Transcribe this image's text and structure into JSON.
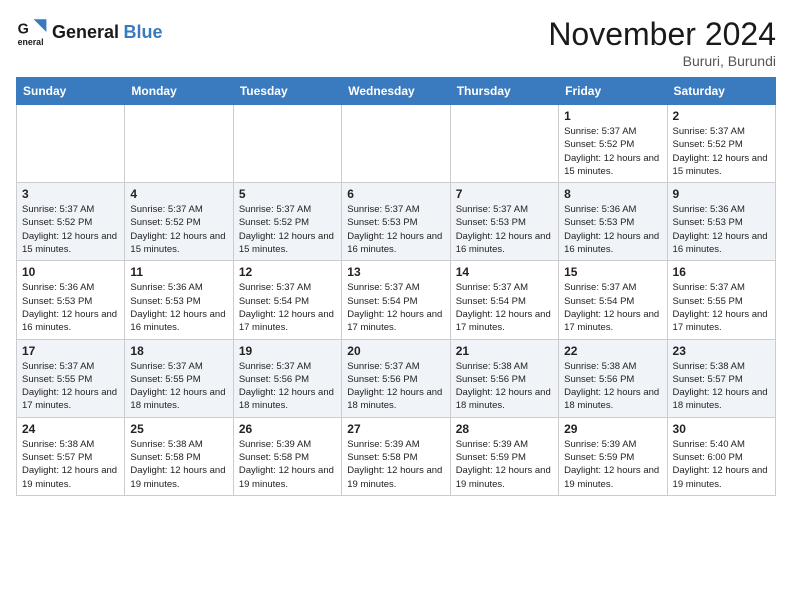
{
  "header": {
    "logo_line1": "General",
    "logo_line2": "Blue",
    "month": "November 2024",
    "location": "Bururi, Burundi"
  },
  "weekdays": [
    "Sunday",
    "Monday",
    "Tuesday",
    "Wednesday",
    "Thursday",
    "Friday",
    "Saturday"
  ],
  "weeks": [
    [
      {
        "day": "",
        "sunrise": "",
        "sunset": "",
        "daylight": ""
      },
      {
        "day": "",
        "sunrise": "",
        "sunset": "",
        "daylight": ""
      },
      {
        "day": "",
        "sunrise": "",
        "sunset": "",
        "daylight": ""
      },
      {
        "day": "",
        "sunrise": "",
        "sunset": "",
        "daylight": ""
      },
      {
        "day": "",
        "sunrise": "",
        "sunset": "",
        "daylight": ""
      },
      {
        "day": "1",
        "sunrise": "5:37 AM",
        "sunset": "5:52 PM",
        "daylight": "12 hours and 15 minutes."
      },
      {
        "day": "2",
        "sunrise": "5:37 AM",
        "sunset": "5:52 PM",
        "daylight": "12 hours and 15 minutes."
      }
    ],
    [
      {
        "day": "3",
        "sunrise": "5:37 AM",
        "sunset": "5:52 PM",
        "daylight": "12 hours and 15 minutes."
      },
      {
        "day": "4",
        "sunrise": "5:37 AM",
        "sunset": "5:52 PM",
        "daylight": "12 hours and 15 minutes."
      },
      {
        "day": "5",
        "sunrise": "5:37 AM",
        "sunset": "5:52 PM",
        "daylight": "12 hours and 15 minutes."
      },
      {
        "day": "6",
        "sunrise": "5:37 AM",
        "sunset": "5:53 PM",
        "daylight": "12 hours and 16 minutes."
      },
      {
        "day": "7",
        "sunrise": "5:37 AM",
        "sunset": "5:53 PM",
        "daylight": "12 hours and 16 minutes."
      },
      {
        "day": "8",
        "sunrise": "5:36 AM",
        "sunset": "5:53 PM",
        "daylight": "12 hours and 16 minutes."
      },
      {
        "day": "9",
        "sunrise": "5:36 AM",
        "sunset": "5:53 PM",
        "daylight": "12 hours and 16 minutes."
      }
    ],
    [
      {
        "day": "10",
        "sunrise": "5:36 AM",
        "sunset": "5:53 PM",
        "daylight": "12 hours and 16 minutes."
      },
      {
        "day": "11",
        "sunrise": "5:36 AM",
        "sunset": "5:53 PM",
        "daylight": "12 hours and 16 minutes."
      },
      {
        "day": "12",
        "sunrise": "5:37 AM",
        "sunset": "5:54 PM",
        "daylight": "12 hours and 17 minutes."
      },
      {
        "day": "13",
        "sunrise": "5:37 AM",
        "sunset": "5:54 PM",
        "daylight": "12 hours and 17 minutes."
      },
      {
        "day": "14",
        "sunrise": "5:37 AM",
        "sunset": "5:54 PM",
        "daylight": "12 hours and 17 minutes."
      },
      {
        "day": "15",
        "sunrise": "5:37 AM",
        "sunset": "5:54 PM",
        "daylight": "12 hours and 17 minutes."
      },
      {
        "day": "16",
        "sunrise": "5:37 AM",
        "sunset": "5:55 PM",
        "daylight": "12 hours and 17 minutes."
      }
    ],
    [
      {
        "day": "17",
        "sunrise": "5:37 AM",
        "sunset": "5:55 PM",
        "daylight": "12 hours and 17 minutes."
      },
      {
        "day": "18",
        "sunrise": "5:37 AM",
        "sunset": "5:55 PM",
        "daylight": "12 hours and 18 minutes."
      },
      {
        "day": "19",
        "sunrise": "5:37 AM",
        "sunset": "5:56 PM",
        "daylight": "12 hours and 18 minutes."
      },
      {
        "day": "20",
        "sunrise": "5:37 AM",
        "sunset": "5:56 PM",
        "daylight": "12 hours and 18 minutes."
      },
      {
        "day": "21",
        "sunrise": "5:38 AM",
        "sunset": "5:56 PM",
        "daylight": "12 hours and 18 minutes."
      },
      {
        "day": "22",
        "sunrise": "5:38 AM",
        "sunset": "5:56 PM",
        "daylight": "12 hours and 18 minutes."
      },
      {
        "day": "23",
        "sunrise": "5:38 AM",
        "sunset": "5:57 PM",
        "daylight": "12 hours and 18 minutes."
      }
    ],
    [
      {
        "day": "24",
        "sunrise": "5:38 AM",
        "sunset": "5:57 PM",
        "daylight": "12 hours and 19 minutes."
      },
      {
        "day": "25",
        "sunrise": "5:38 AM",
        "sunset": "5:58 PM",
        "daylight": "12 hours and 19 minutes."
      },
      {
        "day": "26",
        "sunrise": "5:39 AM",
        "sunset": "5:58 PM",
        "daylight": "12 hours and 19 minutes."
      },
      {
        "day": "27",
        "sunrise": "5:39 AM",
        "sunset": "5:58 PM",
        "daylight": "12 hours and 19 minutes."
      },
      {
        "day": "28",
        "sunrise": "5:39 AM",
        "sunset": "5:59 PM",
        "daylight": "12 hours and 19 minutes."
      },
      {
        "day": "29",
        "sunrise": "5:39 AM",
        "sunset": "5:59 PM",
        "daylight": "12 hours and 19 minutes."
      },
      {
        "day": "30",
        "sunrise": "5:40 AM",
        "sunset": "6:00 PM",
        "daylight": "12 hours and 19 minutes."
      }
    ]
  ],
  "labels": {
    "sunrise": "Sunrise:",
    "sunset": "Sunset:",
    "daylight": "Daylight:"
  }
}
